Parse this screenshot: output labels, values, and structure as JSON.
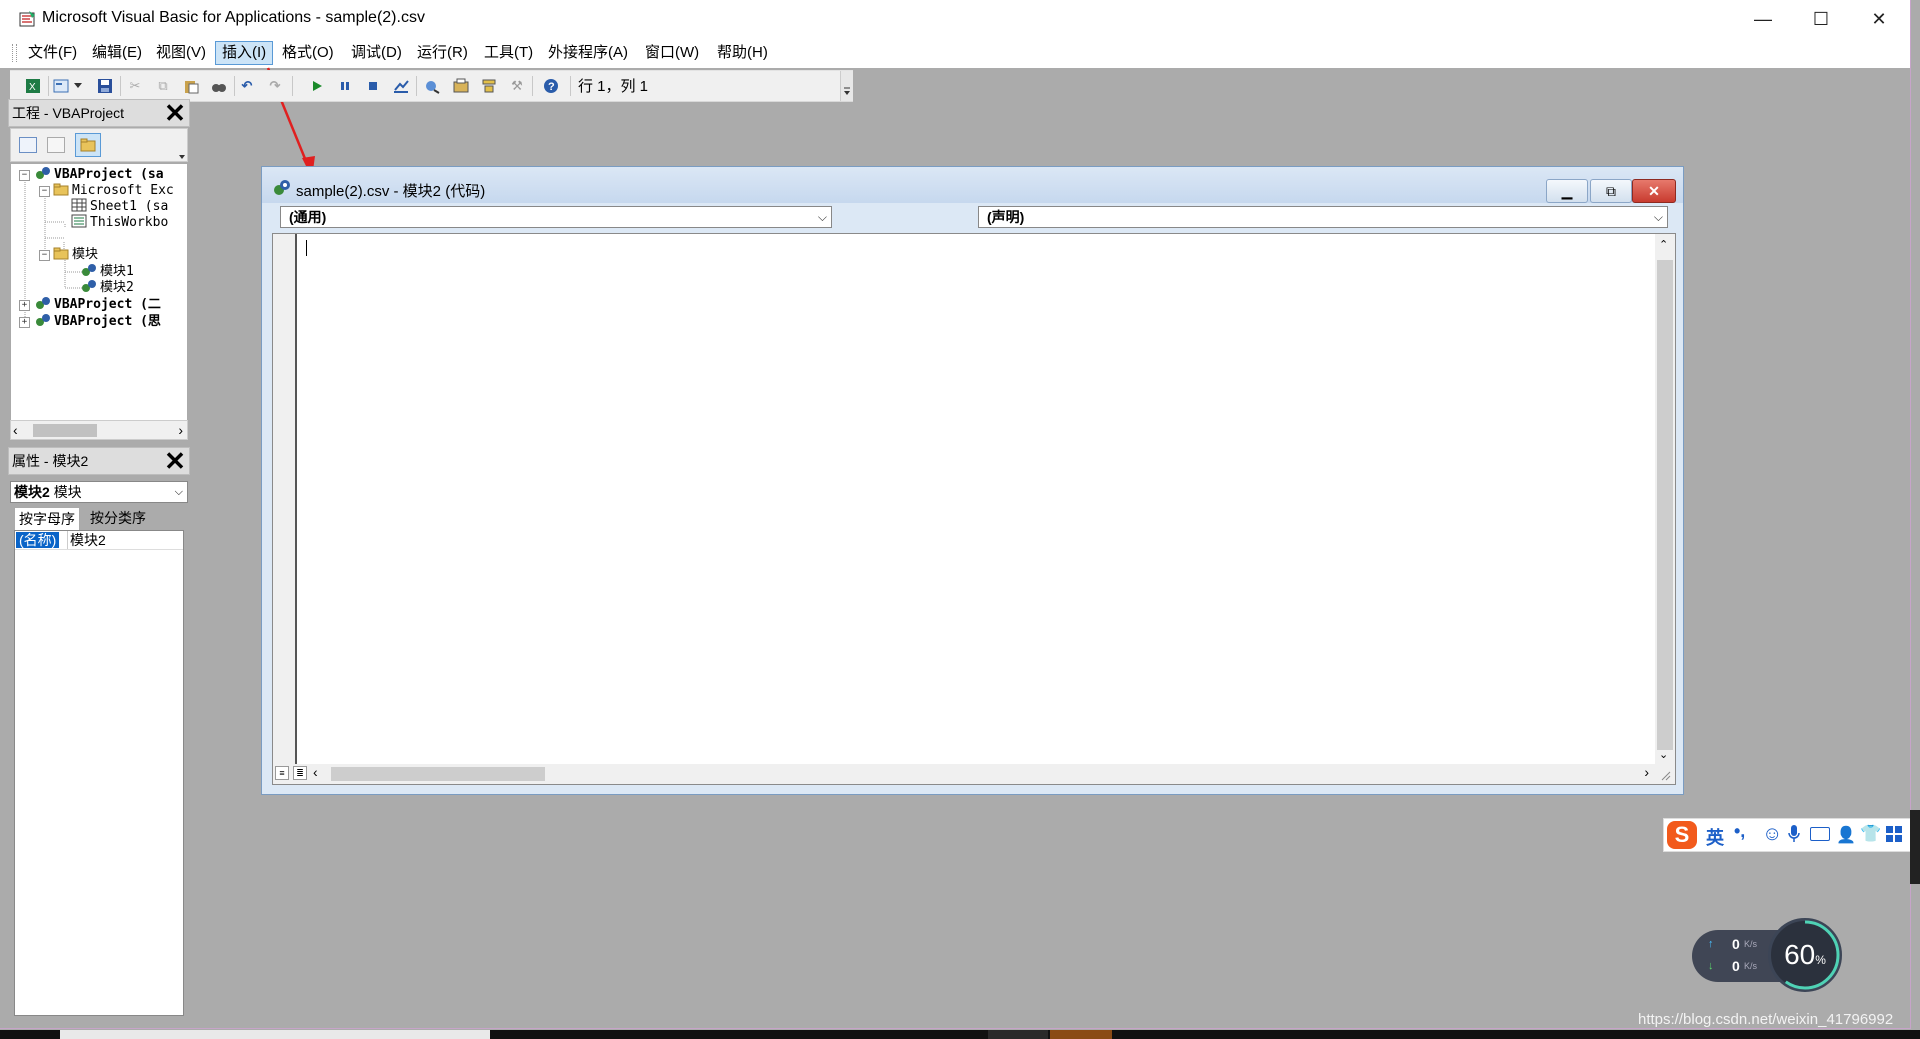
{
  "window": {
    "title": "Microsoft Visual Basic for Applications - sample(2).csv",
    "minimize": "—",
    "maximize": "☐",
    "close": "✕"
  },
  "menu": {
    "items": [
      {
        "label": "文件(F)"
      },
      {
        "label": "编辑(E)"
      },
      {
        "label": "视图(V)"
      },
      {
        "label": "插入(I)"
      },
      {
        "label": "格式(O)"
      },
      {
        "label": "调试(D)"
      },
      {
        "label": "运行(R)"
      },
      {
        "label": "工具(T)"
      },
      {
        "label": "外接程序(A)"
      },
      {
        "label": "窗口(W)"
      },
      {
        "label": "帮助(H)"
      }
    ],
    "active_index": 3
  },
  "toolbar": {
    "cursor_position": "行 1，列 1"
  },
  "project_panel": {
    "title": "工程 - VBAProject",
    "tree": [
      {
        "label": "VBAProject (sa",
        "bold": true
      },
      {
        "label": "Microsoft Exc"
      },
      {
        "label": "Sheet1 (sa"
      },
      {
        "label": "ThisWorkbo"
      },
      {
        "label": "模块"
      },
      {
        "label": "模块1"
      },
      {
        "label": "模块2"
      },
      {
        "label": "VBAProject (二",
        "bold": true
      },
      {
        "label": "VBAProject (思",
        "bold": true
      }
    ]
  },
  "properties_panel": {
    "title": "属性 - 模块2",
    "object_name": "模块2",
    "object_type": "模块",
    "tabs": [
      "按字母序",
      "按分类序"
    ],
    "rows": [
      {
        "name": "(名称)",
        "value": "模块2"
      }
    ]
  },
  "code_window": {
    "title": "sample(2).csv - 模块2 (代码)",
    "object_combo": "(通用)",
    "procedure_combo": "(声明)"
  },
  "ime": {
    "mode": "英",
    "logo": "S"
  },
  "network": {
    "upload": "0",
    "download": "0",
    "unit": "K/s",
    "percent": "60",
    "percent_sign": "%"
  },
  "watermark": "https://blog.csdn.net/weixin_41796992",
  "colors": {
    "accent": "#5a9ad6",
    "close_red": "#c83b2f",
    "highlight": "#0a64c8"
  }
}
